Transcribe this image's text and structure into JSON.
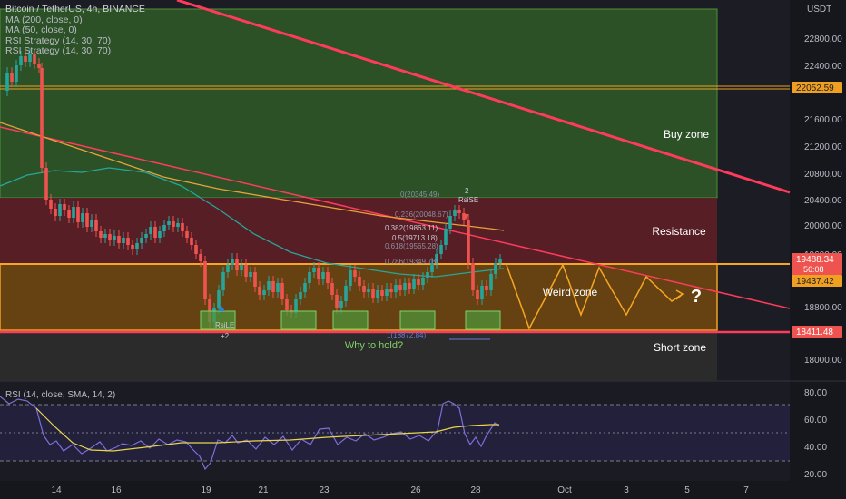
{
  "legend": {
    "symbol": "Bitcoin / TetherUS, 4h, BINANCE",
    "ma1": "MA (200, close, 0)",
    "ma2": "MA (50, close, 0)",
    "rsi1": "RSI Strategy (14, 30, 70)",
    "rsi2": "RSI Strategy (14, 30, 70)"
  },
  "currency": "USDT",
  "price_axis": {
    "ticks": [
      "22800.00",
      "22400.00",
      "21600.00",
      "21200.00",
      "20800.00",
      "20400.00",
      "20000.00",
      "19600.00",
      "18800.00",
      "18000.00"
    ]
  },
  "price_tags": {
    "level_high": "22052.59",
    "current_price": "19488.34",
    "countdown": "56:08",
    "ma_level": "19437.42",
    "level_low": "18411.48"
  },
  "rsi_axis": {
    "ticks": [
      "80.00",
      "60.00",
      "40.00",
      "20.00"
    ]
  },
  "rsi_legend": "RSI (14, close, SMA, 14, 2)",
  "time_axis": {
    "ticks": [
      "14",
      "16",
      "19",
      "21",
      "23",
      "26",
      "28",
      "Oct",
      "3",
      "5",
      "7"
    ]
  },
  "zones": {
    "buy": "Buy zone",
    "resistance": "Resistance",
    "weird": "Weird zone",
    "short": "Short zone"
  },
  "annotations": {
    "question": "?",
    "why_hold": "Why to hold?",
    "rsi_le": "RsiLE",
    "rsi_le_count": "+2",
    "rsi_se": "RsiSE",
    "rsi_se_count": "2"
  },
  "fib_labels": {
    "f0": "0(20345.49)",
    "f236": "0.236(20048.67)",
    "f382": "0.382(19863.11)",
    "f5": "0.5(19713.18)",
    "f618": "0.618(19565.28)",
    "f786": "0.786(19349.78)",
    "f1": "1(18872.84)"
  },
  "colors": {
    "background": "#1c1c24",
    "buy_zone": "#3a7d2c",
    "resistance_zone": "#a6303c",
    "weird_zone": "#c8820e",
    "short_zone": "#3a3a3a",
    "bull_candle": "#26a69a",
    "bear_candle": "#ef5350",
    "trend_line": "#ff3b5c",
    "zigzag": "#f5a623",
    "rsi_line": "#7e6fd9",
    "rsi_sma": "#e8d44d"
  }
}
